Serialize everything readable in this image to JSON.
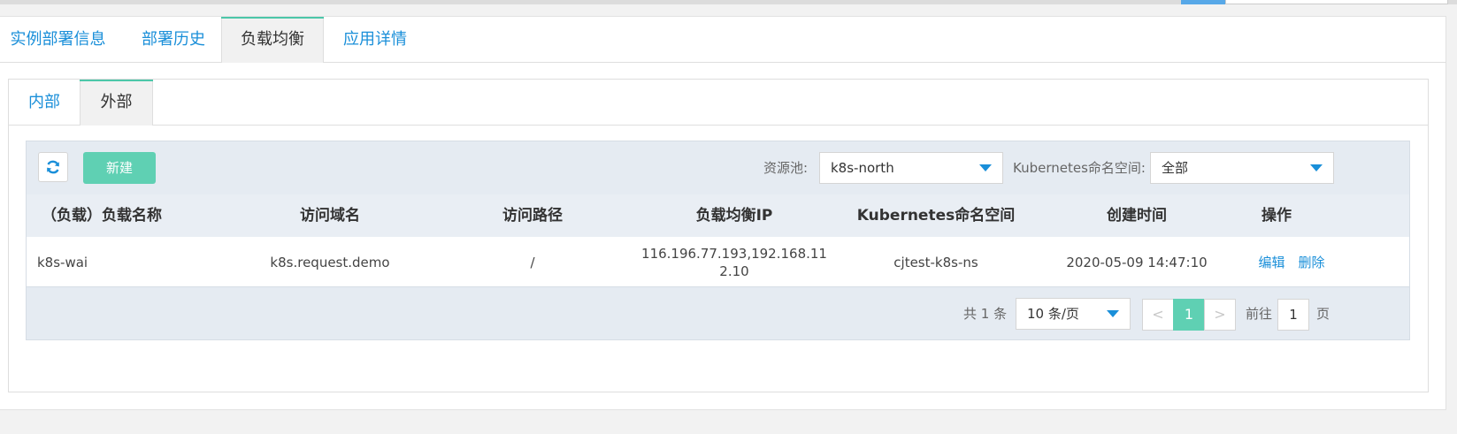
{
  "top_tabs": [
    {
      "label": "实例部署信息",
      "active": false
    },
    {
      "label": "部署历史",
      "active": false
    },
    {
      "label": "负载均衡",
      "active": true
    },
    {
      "label": "应用详情",
      "active": false
    }
  ],
  "sub_tabs": [
    {
      "label": "内部",
      "active": false
    },
    {
      "label": "外部",
      "active": true
    }
  ],
  "toolbar": {
    "refresh_icon": "refresh-icon",
    "new_label": "新建",
    "pool_label": "资源池:",
    "pool_value": "k8s-north",
    "namespace_label": "Kubernetes命名空间:",
    "namespace_value": "全部"
  },
  "table": {
    "columns": [
      "（负载）负载名称",
      "访问域名",
      "访问路径",
      "负载均衡IP",
      "Kubernetes命名空间",
      "创建时间",
      "操作"
    ],
    "rows": [
      {
        "name": "k8s-wai",
        "domain": "k8s.request.demo",
        "path": "/",
        "ip": "116.196.77.193,192.168.112.10",
        "namespace": "cjtest-k8s-ns",
        "created": "2020-05-09 14:47:10",
        "actions": [
          "编辑",
          "删除"
        ]
      }
    ]
  },
  "pagination": {
    "total_text": "共 1 条",
    "page_size": "10 条/页",
    "prev": "<",
    "current_page": "1",
    "next": ">",
    "goto_label": "前往",
    "goto_value": "1",
    "page_suffix": "页"
  },
  "colors": {
    "accent": "#1a8fd9",
    "primary_green": "#5fd0b3",
    "tab_indicator": "#4cc7a9"
  }
}
